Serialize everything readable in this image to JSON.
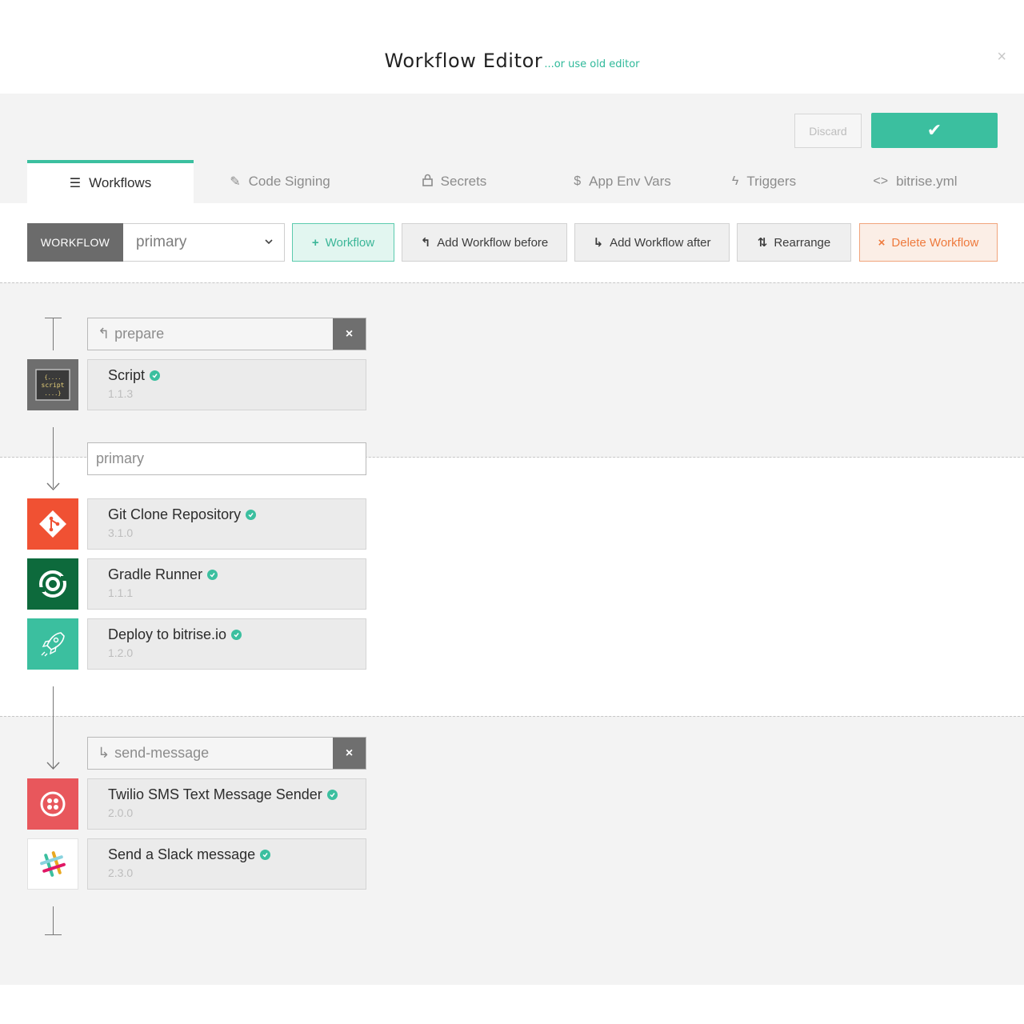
{
  "header": {
    "title": "Workflow Editor",
    "old_editor_link": "...or use old editor",
    "close_icon": "×"
  },
  "actions": {
    "discard_label": "Discard",
    "save_icon": "✔"
  },
  "tabs": [
    {
      "label": "Workflows",
      "icon": "list-icon",
      "glyph": "☰",
      "active": true
    },
    {
      "label": "Code Signing",
      "icon": "edit-icon",
      "glyph": "✎"
    },
    {
      "label": "Secrets",
      "icon": "lock-icon",
      "glyph": "🔒"
    },
    {
      "label": "App Env Vars",
      "icon": "dollar-icon",
      "glyph": "$"
    },
    {
      "label": "Triggers",
      "icon": "bolt-icon",
      "glyph": "ϟ"
    },
    {
      "label": "bitrise.yml",
      "icon": "code-icon",
      "glyph": "<>"
    }
  ],
  "toolbar": {
    "workflow_label": "WORKFLOW",
    "selected_workflow": "primary",
    "add_workflow": "Workflow",
    "add_before": "Add Workflow before",
    "add_after": "Add Workflow after",
    "rearrange": "Rearrange",
    "delete": "Delete Workflow"
  },
  "before_workflows": [
    {
      "name": "prepare",
      "steps": [
        {
          "name": "Script",
          "version": "1.1.3",
          "icon": "script-icon",
          "icon_bg": "#6e6e6e"
        }
      ]
    }
  ],
  "main_workflow": {
    "name": "primary",
    "steps": [
      {
        "name": "Git Clone Repository",
        "version": "3.1.0",
        "icon": "git-icon",
        "icon_bg": "#f05133"
      },
      {
        "name": "Gradle Runner",
        "version": "1.1.1",
        "icon": "gradle-icon",
        "icon_bg": "#0d6a3c"
      },
      {
        "name": "Deploy to bitrise.io",
        "version": "1.2.0",
        "icon": "rocket-icon",
        "icon_bg": "#3bbf9f"
      }
    ]
  },
  "after_workflows": [
    {
      "name": "send-message",
      "steps": [
        {
          "name": "Twilio SMS Text Message Sender",
          "version": "2.0.0",
          "icon": "twilio-icon",
          "icon_bg": "#e8575c"
        },
        {
          "name": "Send a Slack message",
          "version": "2.3.0",
          "icon": "slack-icon",
          "icon_bg": "#ffffff"
        }
      ]
    }
  ],
  "colors": {
    "accent": "#3bbf9f",
    "danger": "#ee7a3d",
    "verified": "#3bbf9f"
  }
}
